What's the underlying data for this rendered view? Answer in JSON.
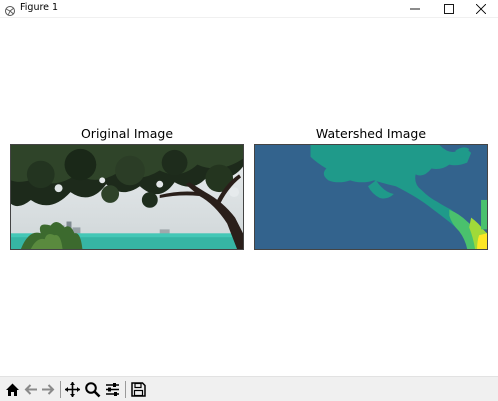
{
  "window": {
    "title": "Figure 1",
    "app_icon": "matplotlib-figure-icon",
    "controls": [
      "minimize-icon",
      "maximize-icon",
      "close-icon"
    ]
  },
  "figure": {
    "subplots": [
      {
        "title": "Original Image",
        "content": "photo of tree branches against sky over water"
      },
      {
        "title": "Watershed Image",
        "content": "segmentation label map"
      }
    ],
    "colors": {
      "watershed_background": "#33638d",
      "watershed_teal": "#1f9a8a",
      "watershed_green": "#4ac16d",
      "watershed_lime": "#a0da39",
      "watershed_yellow": "#fde725"
    }
  },
  "toolbar": {
    "buttons": [
      {
        "name": "home",
        "icon": "home-icon"
      },
      {
        "name": "back",
        "icon": "back-arrow-icon"
      },
      {
        "name": "forward",
        "icon": "forward-arrow-icon"
      },
      {
        "name": "pan",
        "icon": "pan-icon"
      },
      {
        "name": "zoom",
        "icon": "zoom-icon"
      },
      {
        "name": "configure-subplots",
        "icon": "sliders-icon"
      },
      {
        "name": "save",
        "icon": "save-icon"
      }
    ]
  }
}
